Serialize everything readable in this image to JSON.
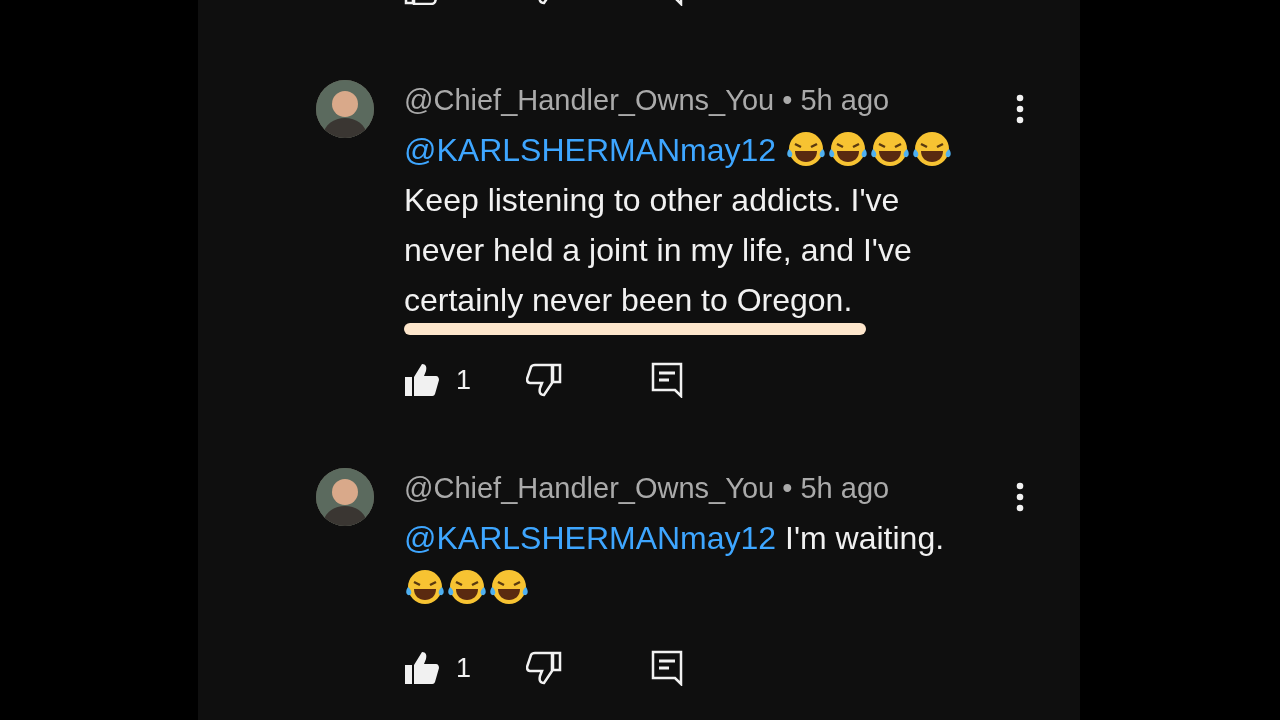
{
  "previous_actions": {
    "liked": false
  },
  "comments": [
    {
      "author": "@Chief_Handler_Owns_You",
      "separator": "•",
      "time": "5h ago",
      "highlighted": true,
      "liked": true,
      "likes": "1",
      "body": [
        {
          "kind": "mention",
          "text": "@KARLSHERMANmay12"
        },
        {
          "kind": "emoji"
        },
        {
          "kind": "emoji"
        },
        {
          "kind": "emoji"
        },
        {
          "kind": "emoji"
        },
        {
          "kind": "text",
          "text": "Keep listening to other addicts. I've never held a joint in my life, and I've certainly never been to Oregon."
        }
      ]
    },
    {
      "author": "@Chief_Handler_Owns_You",
      "separator": "•",
      "time": "5h ago",
      "highlighted": false,
      "liked": true,
      "likes": "1",
      "body": [
        {
          "kind": "mention",
          "text": "@KARLSHERMANmay12"
        },
        {
          "kind": "text",
          "text": "I'm waiting."
        },
        {
          "kind": "emoji"
        },
        {
          "kind": "emoji"
        },
        {
          "kind": "emoji"
        }
      ]
    }
  ]
}
